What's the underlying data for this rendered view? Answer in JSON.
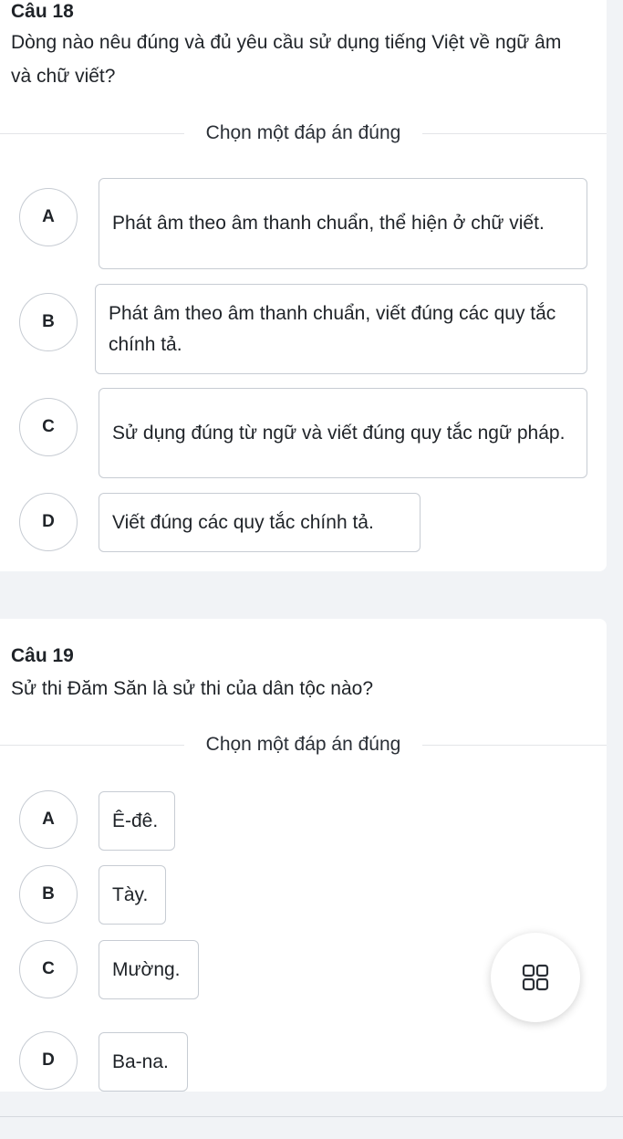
{
  "questions": [
    {
      "title": "Câu 18",
      "text": "Dòng nào nêu đúng và đủ yêu cầu sử dụng tiếng Việt về ngữ âm và chữ viết?",
      "instruction": "Chọn một đáp án đúng",
      "options": [
        {
          "letter": "A",
          "text": "Phát âm theo âm thanh chuẩn, thể hiện ở chữ viết."
        },
        {
          "letter": "B",
          "text": "Phát âm theo âm thanh chuẩn, viết đúng các quy tắc chính tả."
        },
        {
          "letter": "C",
          "text": "Sử dụng đúng từ ngữ và viết đúng quy tắc ngữ pháp."
        },
        {
          "letter": "D",
          "text": "Viết đúng các quy tắc chính tả."
        }
      ]
    },
    {
      "title": "Câu 19",
      "text": "Sử thi Đăm Săn là sử thi của dân tộc nào?",
      "instruction": "Chọn một đáp án đúng",
      "options": [
        {
          "letter": "A",
          "text": "Ê-đê."
        },
        {
          "letter": "B",
          "text": "Tày."
        },
        {
          "letter": "C",
          "text": "Mường."
        },
        {
          "letter": "D",
          "text": "Ba-na."
        }
      ]
    }
  ],
  "fab": {
    "icon": "grid-icon"
  },
  "colors": {
    "background": "#f1f3f6",
    "card": "#ffffff",
    "border": "#c7ccd3",
    "text": "#1f2328"
  }
}
